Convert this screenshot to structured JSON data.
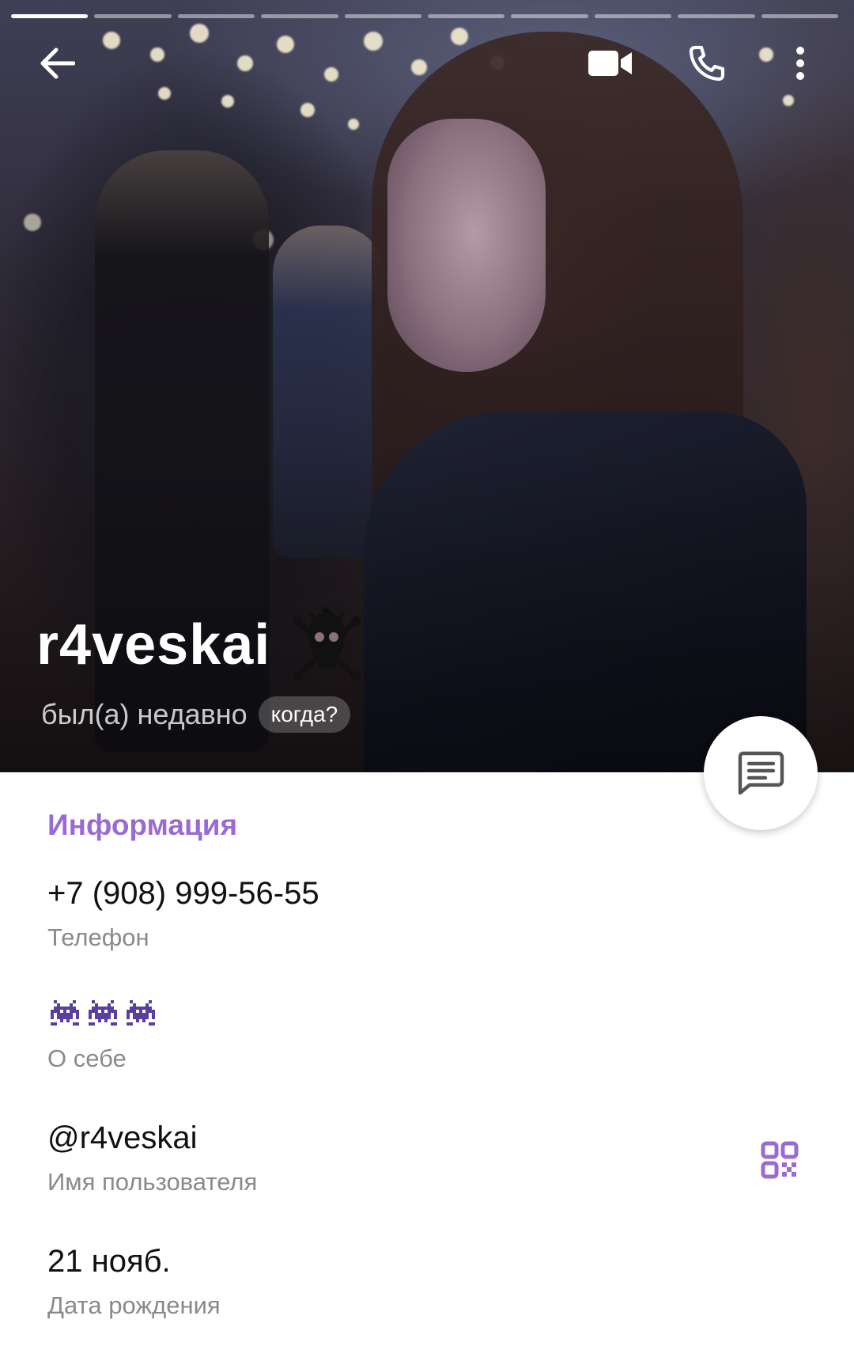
{
  "header": {
    "story_segments": 10,
    "active_segment": 1,
    "icons": [
      "back-arrow-icon",
      "video-camera-icon",
      "phone-icon",
      "more-vertical-icon"
    ]
  },
  "profile": {
    "name": "r4veskai",
    "name_badge_icon": "skull-crossbones-icon",
    "status": "был(а) недавно",
    "when_chip": "когда?"
  },
  "fab": {
    "icon": "message-icon"
  },
  "info": {
    "title": "Информация",
    "phone": {
      "value": "+7 (908) 999-56-55",
      "label": "Телефон"
    },
    "about": {
      "emoji_icons": [
        "purple-alien-icon",
        "purple-alien-icon",
        "purple-alien-icon"
      ],
      "label": "О себе"
    },
    "username": {
      "value": "@r4veskai",
      "label": "Имя пользователя",
      "action_icon": "qr-code-icon"
    },
    "birthday": {
      "value": "21 нояб.",
      "label": "Дата рождения"
    }
  },
  "colors": {
    "accent": "#9a6bd2",
    "label_gray": "#8a8a8a",
    "text_dark": "#111111"
  }
}
